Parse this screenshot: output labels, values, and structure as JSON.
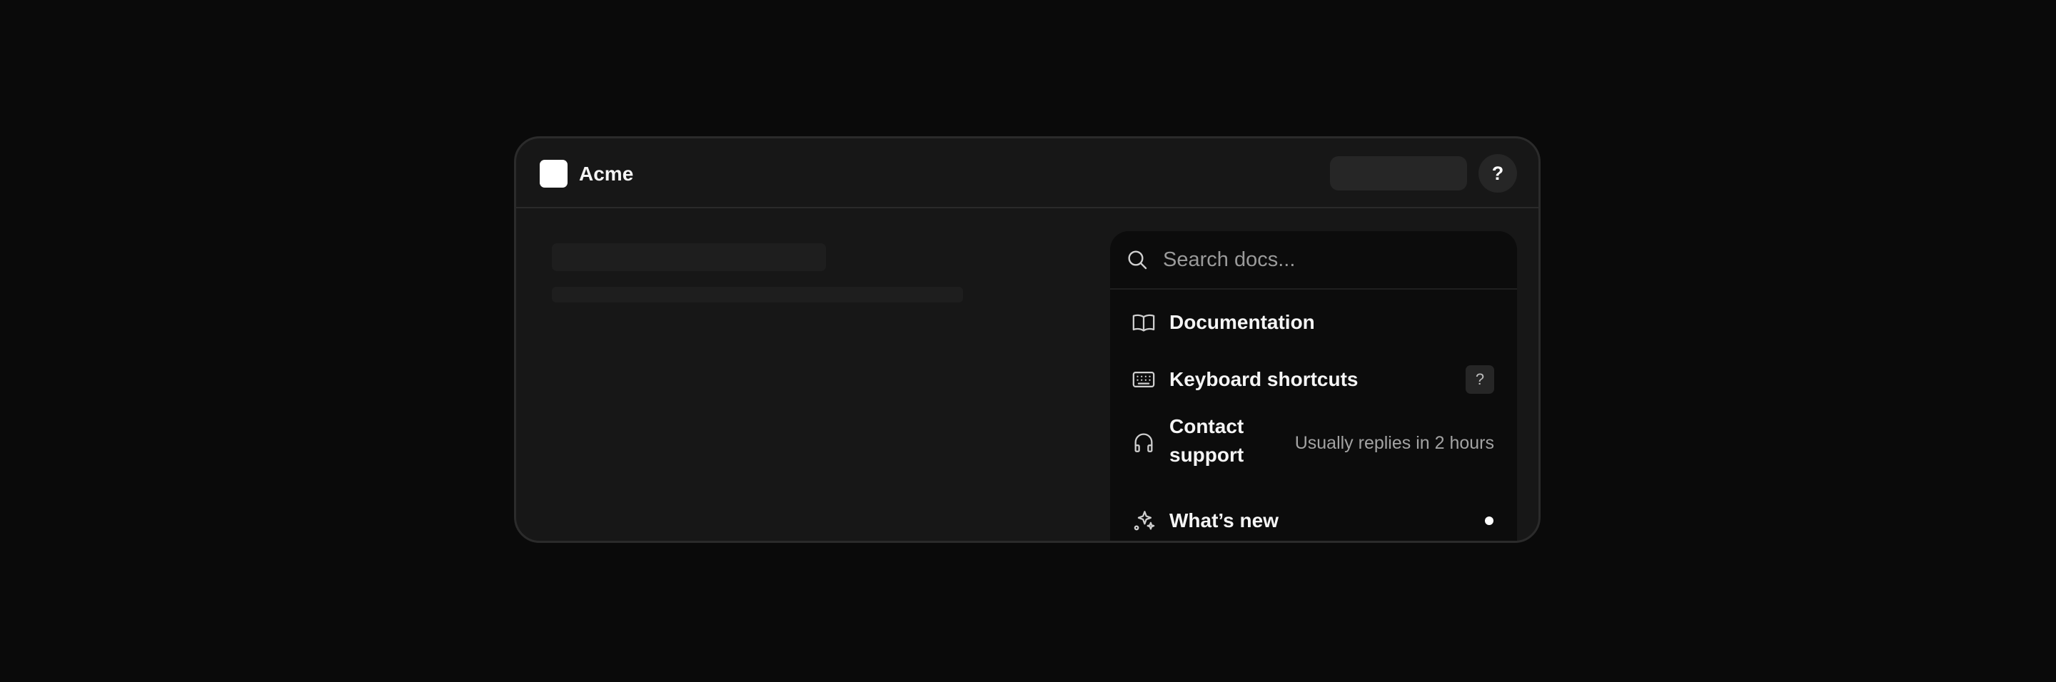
{
  "app": {
    "name": "Acme"
  },
  "header": {
    "help_label": "?"
  },
  "search": {
    "placeholder": "Search docs..."
  },
  "menu": {
    "items": [
      {
        "label": "Documentation",
        "icon": "book-icon"
      },
      {
        "label": "Keyboard shortcuts",
        "icon": "keyboard-icon",
        "shortcut": "?"
      },
      {
        "label_line1": "Contact",
        "label_line2": "support",
        "icon": "headphones-icon",
        "meta": "Usually replies in 2 hours"
      },
      {
        "label": "What’s new",
        "icon": "sparkles-icon",
        "badge": "unread-dot"
      }
    ]
  },
  "colors": {
    "background": "#0a0a0a",
    "window": "#171717",
    "popover": "#0c0c0c",
    "text": "#f5f5f5",
    "muted": "#a3a3a3"
  }
}
